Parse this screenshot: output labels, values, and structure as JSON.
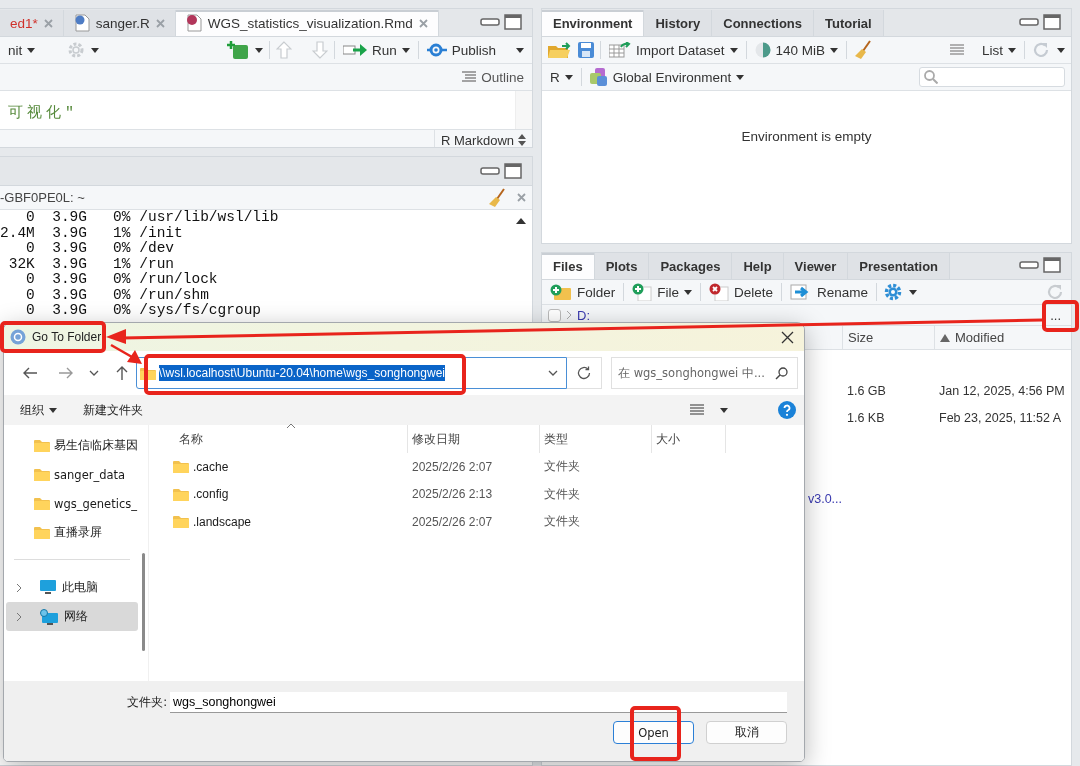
{
  "source_pane": {
    "tabs": [
      {
        "label": "ed1*",
        "kind": "plain",
        "unsaved": true,
        "selected": false
      },
      {
        "label": "sanger.R",
        "kind": "r",
        "unsaved": false,
        "selected": false
      },
      {
        "label": "WGS_statistics_visualization.Rmd",
        "kind": "rmd",
        "unsaved": false,
        "selected": true
      }
    ],
    "knit_label": "nit",
    "run_label": "Run",
    "publish_label": "Publish",
    "outline_label": "Outline",
    "editor_text": "可视化\"",
    "file_type": "R Markdown"
  },
  "console_pane": {
    "title": "-GBF0PE0L: ~",
    "lines": [
      "   0  3.9G   0% /usr/lib/wsl/lib",
      "2.4M  3.9G   1% /init",
      "   0  3.9G   0% /dev",
      " 32K  3.9G   1% /run",
      "   0  3.9G   0% /run/lock",
      "   0  3.9G   0% /run/shm",
      "   0  3.9G   0% /sys/fs/cgroup"
    ]
  },
  "environment_pane": {
    "tabs": [
      {
        "label": "Environment",
        "selected": true
      },
      {
        "label": "History",
        "selected": false
      },
      {
        "label": "Connections",
        "selected": false
      },
      {
        "label": "Tutorial",
        "selected": false
      }
    ],
    "import_label": "Import Dataset",
    "memory_label": "140 MiB",
    "view_label": "List",
    "language": "R",
    "scope": "Global Environment",
    "empty_message": "Environment is empty"
  },
  "files_pane": {
    "tabs": [
      {
        "label": "Files",
        "selected": true
      },
      {
        "label": "Plots",
        "selected": false
      },
      {
        "label": "Packages",
        "selected": false
      },
      {
        "label": "Help",
        "selected": false
      },
      {
        "label": "Viewer",
        "selected": false
      },
      {
        "label": "Presentation",
        "selected": false
      }
    ],
    "actions": [
      {
        "label": "Folder",
        "kind": "new-folder",
        "menu": false
      },
      {
        "label": "File",
        "kind": "new-file",
        "menu": true
      },
      {
        "label": "Delete",
        "kind": "delete",
        "menu": false
      },
      {
        "label": "Rename",
        "kind": "rename",
        "menu": false
      }
    ],
    "path_checked": false,
    "path": "D:",
    "more_label": "...",
    "columns": [
      {
        "label": "Size",
        "sorted": false
      },
      {
        "label": "Modified",
        "sorted": true
      }
    ],
    "rows": [
      {
        "size": "1.6 GB",
        "modified": "Jan 12, 2025, 4:56 PM"
      },
      {
        "size": "1.6 KB",
        "modified": "Feb 23, 2025, 11:52 A"
      }
    ],
    "partial_name": "v3.0..."
  },
  "dialog": {
    "title": "Go To Folder",
    "address": "\\\\wsl.localhost\\Ubuntu-20.04\\home\\wgs_songhongwei",
    "address_selected": true,
    "search_placeholder": "在 wgs_songhongwei 中...",
    "organize_label": "组织",
    "new_folder_label": "新建文件夹",
    "quick_access": [
      {
        "label": "易生信临床基因"
      },
      {
        "label": "sanger_data"
      },
      {
        "label": "wgs_genetics_"
      },
      {
        "label": "直播录屏"
      }
    ],
    "locations": [
      {
        "label": "此电脑",
        "kind": "computer",
        "selected": false
      },
      {
        "label": "网络",
        "kind": "network",
        "selected": true
      }
    ],
    "columns": [
      "名称",
      "修改日期",
      "类型",
      "大小"
    ],
    "rows": [
      {
        "name": ".cache",
        "modified": "2025/2/26 2:07",
        "type": "文件夹"
      },
      {
        "name": ".config",
        "modified": "2025/2/26 2:13",
        "type": "文件夹"
      },
      {
        "name": ".landscape",
        "modified": "2025/2/26 2:07",
        "type": "文件夹"
      }
    ],
    "folder_label": "文件夹:",
    "folder_value": "wgs_songhongwei",
    "buttons": [
      {
        "label": "Open",
        "default": true
      },
      {
        "label": "取消",
        "default": false
      }
    ]
  }
}
